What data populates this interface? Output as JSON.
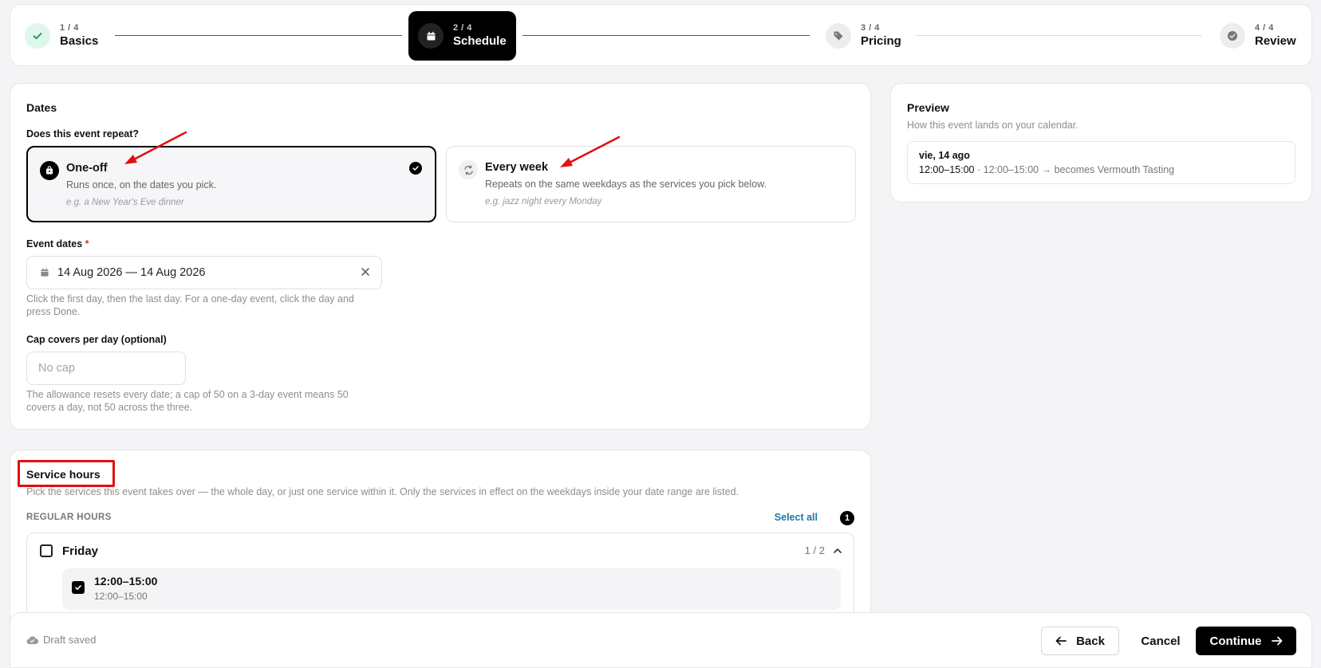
{
  "stepper": {
    "steps": [
      {
        "num": "1 / 4",
        "label": "Basics",
        "state": "done"
      },
      {
        "num": "2 / 4",
        "label": "Schedule",
        "state": "active"
      },
      {
        "num": "3 / 4",
        "label": "Pricing",
        "state": "todo"
      },
      {
        "num": "4 / 4",
        "label": "Review",
        "state": "todo"
      }
    ]
  },
  "dates": {
    "title": "Dates",
    "repeat_question": "Does this event repeat?",
    "options": [
      {
        "title": "One-off",
        "desc": "Runs once, on the dates you pick.",
        "example": "e.g. a New Year's Eve dinner",
        "selected": true
      },
      {
        "title": "Every week",
        "desc": "Repeats on the same weekdays as the services you pick below.",
        "example": "e.g. jazz night every Monday",
        "selected": false
      }
    ],
    "event_dates_label": "Event dates",
    "required_mark": "*",
    "event_dates_value": "14 Aug 2026 — 14 Aug 2026",
    "event_dates_help_1": "Click the first day, then the last day. For a one-day event, click the day and",
    "event_dates_help_2": "press Done.",
    "cap_label": "Cap covers per day (optional)",
    "cap_placeholder": "No cap",
    "cap_help_1": "The allowance resets every date; a cap of 50 on a 3-day event means 50",
    "cap_help_2": "covers a day, not 50 across the three."
  },
  "preview": {
    "title": "Preview",
    "subtitle": "How this event lands on your calendar.",
    "day": "vie, 14 ago",
    "time_bold": "12:00–15:00",
    "time_rest": " · 12:00–15:00 → becomes Vermouth Tasting"
  },
  "service": {
    "title": "Service hours",
    "desc": "Pick the services this event takes over — the whole day, or just one service within it. Only the services in effect on the weekdays inside your date range are listed.",
    "regular_label": "REGULAR HOURS",
    "select_all": "Select all",
    "selected_count": "1",
    "day_name": "Friday",
    "day_count": "1 / 2",
    "slot_title": "12:00–15:00",
    "slot_sub": "12:00–15:00"
  },
  "footer": {
    "draft_status": "Draft saved",
    "back": "Back",
    "cancel": "Cancel",
    "continue": "Continue"
  },
  "colors": {
    "accent": "#000000",
    "done_bg": "#dff6ea",
    "done_check": "#1b8f55",
    "link": "#1b78a8",
    "required": "#e0342f",
    "annotation": "#e01010"
  }
}
